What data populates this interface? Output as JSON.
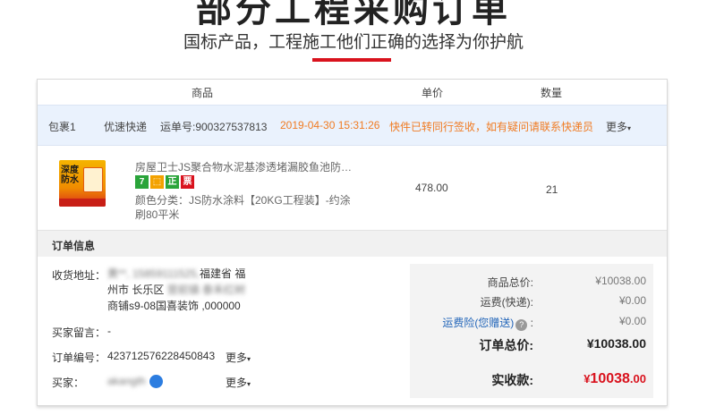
{
  "hero": {
    "title": "部分工程采购订单",
    "subtitle": "国标产品，工程施工他们正确的选择为你护航"
  },
  "table_header": {
    "product": "商品",
    "price": "单价",
    "quantity": "数量"
  },
  "package": {
    "label": "包裹1",
    "carrier": "优速快递",
    "tracking": "运单号:900327537813",
    "time": "2019-04-30 15:31:26",
    "status": "快件已转同行签收，如有疑问请联系快递员",
    "more": "更多"
  },
  "product": {
    "image_text": "深度防水",
    "title": "房屋卫士JS聚合物水泥基渗透堵漏胶鱼池防水涂料",
    "badges": [
      "7",
      "⬚",
      "正",
      "票"
    ],
    "spec": "颜色分类：JS防水涂料【20KG工程装】-约涂刷80平米",
    "price": "478.00",
    "quantity": "21"
  },
  "order_info": {
    "heading": "订单信息",
    "address_label": "收货地址：",
    "address_hidden": "黄**, 15859111525,",
    "address_line1": "福建省 福",
    "address_line2_visible": "州市 长乐区",
    "address_line2_hidden": "营前镇 泰禾红树",
    "address_line3": "商铺s9-08国喜装饰 ,000000",
    "message_label": "买家留言：",
    "message_value": "-",
    "order_no_label": "订单编号：",
    "order_no_value": "423712576228450843",
    "buyer_label": "买家：",
    "buyer_value": "akangth",
    "more": "更多"
  },
  "summary": {
    "goods_label": "商品总价:",
    "goods_value": "¥10038.00",
    "shipping_label": "运费(快递):",
    "shipping_value": "¥0.00",
    "insurance_label": "运费险(您赠送)",
    "insurance_suffix": ":",
    "insurance_value": "¥0.00",
    "total_label": "订单总价:",
    "total_value": "¥10038.00",
    "paid_label": "实收款:",
    "paid_symbol": "¥",
    "paid_int": "10038",
    "paid_dec": ".00"
  },
  "colors": {
    "accent_red": "#d9121d",
    "link_blue": "#1f63b8",
    "status_orange": "#f07b22",
    "package_bg": "#eaf2fd"
  },
  "badge_colors": [
    "#2aa43a",
    "#f3a200",
    "#2aa43a",
    "#d9121d"
  ]
}
